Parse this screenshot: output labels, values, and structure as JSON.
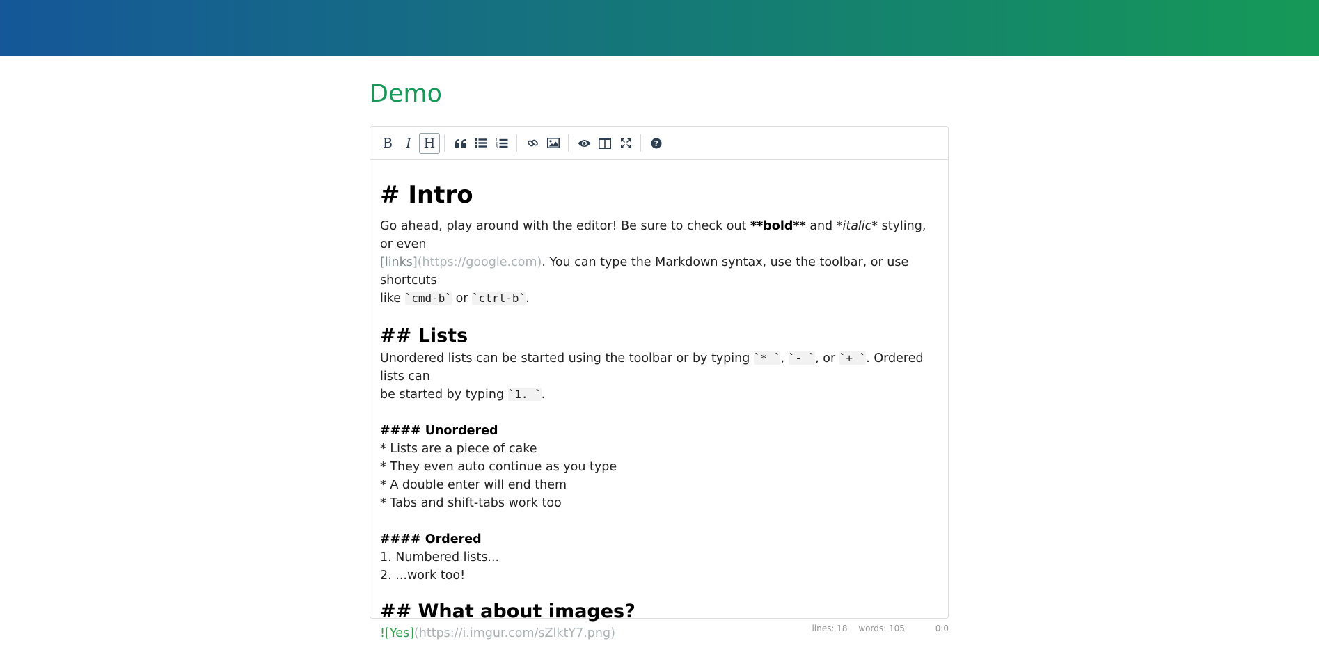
{
  "page": {
    "title": "Demo"
  },
  "colors": {
    "banner_start": "#155799",
    "banner_end": "#159957",
    "title": "#159957"
  },
  "toolbar": {
    "buttons": [
      {
        "name": "bold-button",
        "icon": "bold-icon",
        "glyph": "B"
      },
      {
        "name": "italic-button",
        "icon": "italic-icon",
        "glyph": "I"
      },
      {
        "name": "heading-button",
        "icon": "heading-icon",
        "glyph": "H",
        "active": true
      },
      {
        "name": "quote-button",
        "icon": "quote-icon"
      },
      {
        "name": "unordered-list-button",
        "icon": "unordered-list-icon"
      },
      {
        "name": "ordered-list-button",
        "icon": "ordered-list-icon"
      },
      {
        "name": "link-button",
        "icon": "link-icon"
      },
      {
        "name": "image-button",
        "icon": "image-icon"
      },
      {
        "name": "preview-button",
        "icon": "eye-icon"
      },
      {
        "name": "side-by-side-button",
        "icon": "columns-icon"
      },
      {
        "name": "fullscreen-button",
        "icon": "expand-icon"
      },
      {
        "name": "guide-button",
        "icon": "question-icon"
      }
    ]
  },
  "editor": {
    "intro_heading": "# Intro",
    "intro_p1": "Go ahead, play around with the editor! Be sure to check out ",
    "intro_bold": "**bold**",
    "intro_and": " and ",
    "intro_italic": "*italic*",
    "intro_p2": " styling, or even",
    "intro_link_text": "[links]",
    "intro_link_url": "(https://google.com)",
    "intro_p3": ". You can type the Markdown syntax, use the toolbar, or use shortcuts",
    "intro_p4": "like ",
    "intro_code1": "`cmd-b`",
    "intro_or": " or ",
    "intro_code2": "`ctrl-b`",
    "intro_end": ".",
    "lists_heading": "## Lists",
    "lists_p1": "Unordered lists can be started using the toolbar or by typing ",
    "lists_code1": "`* `",
    "lists_comma1": ", ",
    "lists_code2": "`- `",
    "lists_or": ", or ",
    "lists_code3": "`+ `",
    "lists_p2": ". Ordered lists can",
    "lists_p3": "be started by typing ",
    "lists_code4": "`1. `",
    "lists_end": ".",
    "unordered_heading": "#### Unordered",
    "unordered_items": [
      "* Lists are a piece of cake",
      "* They even auto continue as you type",
      "* A double enter will end them",
      "* Tabs and shift-tabs work too"
    ],
    "ordered_heading": "#### Ordered",
    "ordered_items": [
      "1. Numbered lists...",
      "2. ...work too!"
    ],
    "images_heading": "## What about images?",
    "image_bang": "!",
    "image_alt": "[Yes]",
    "image_url": "(https://i.imgur.com/sZlktY7.png)"
  },
  "status": {
    "lines": "lines: 18",
    "words": "words: 105",
    "cursor": "0:0"
  }
}
